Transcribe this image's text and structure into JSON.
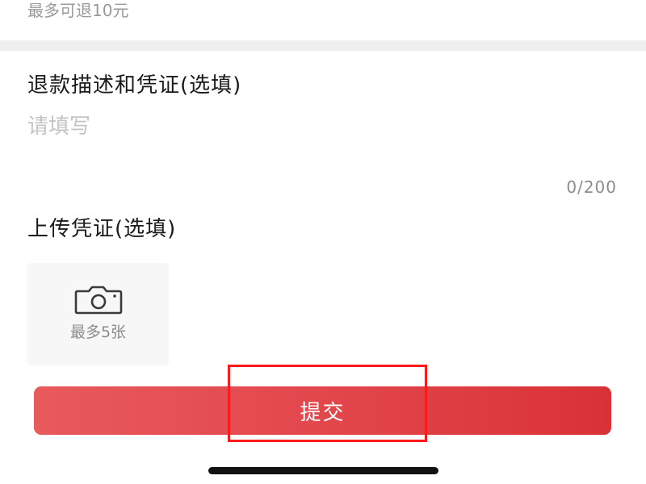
{
  "refund": {
    "max_amount_text": "最多可退10元"
  },
  "description": {
    "title": "退款描述和凭证(选填)",
    "placeholder": "请填写",
    "value": "",
    "char_count": "0/200"
  },
  "upload": {
    "title": "上传凭证(选填)",
    "icon": "camera-icon",
    "hint": "最多5张"
  },
  "submit": {
    "label": "提交"
  },
  "colors": {
    "accent": "#e2474c",
    "highlight": "#ff1a1a",
    "placeholder": "#c4c4c4",
    "muted": "#8c8c8c"
  }
}
